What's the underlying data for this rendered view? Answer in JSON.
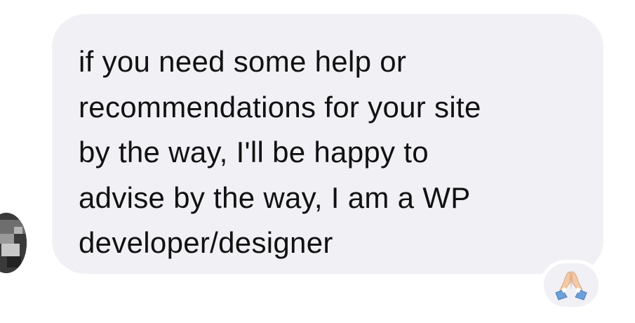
{
  "message": {
    "text": "if you need some help or\nrecommendations for your site\nby the way, I'll be happy to\nadvise by the way, I am a WP\ndeveloper/designer"
  },
  "reaction": {
    "emoji": "🙏",
    "icon": "folded-hands-icon"
  },
  "colors": {
    "bubble": "#f0f0f5",
    "text": "#111111",
    "sleeve": "#6d9fd8"
  }
}
